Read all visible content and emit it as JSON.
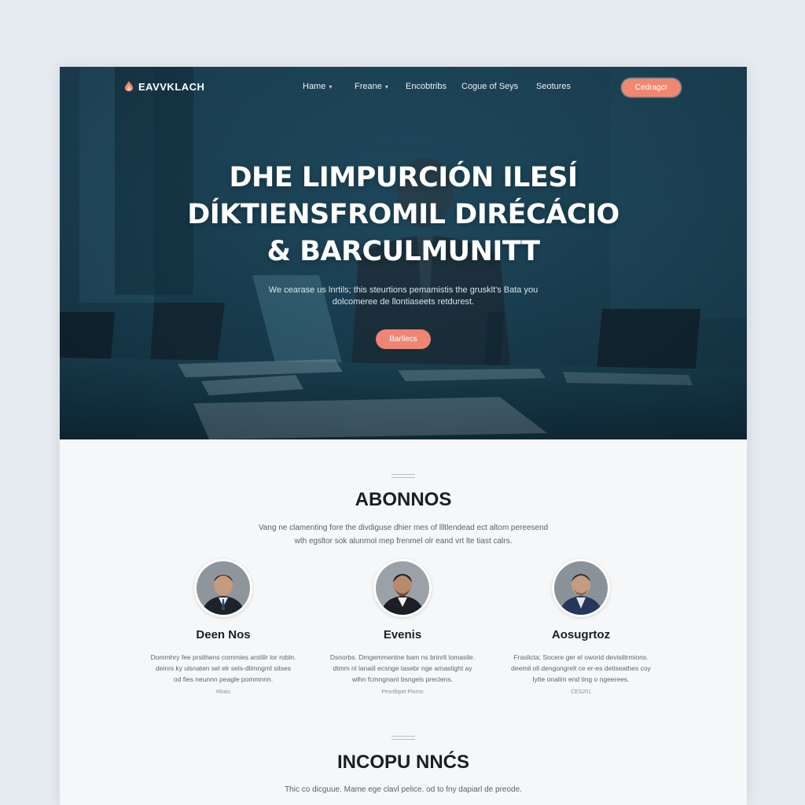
{
  "nav": {
    "logo_text": "EAVVKLACH",
    "links": [
      {
        "label": "Hame",
        "has_dropdown": true
      },
      {
        "label": "Freane",
        "has_dropdown": true
      },
      {
        "label": "Encobtribs",
        "has_dropdown": false
      },
      {
        "label": "Cogue of Seys",
        "has_dropdown": false
      },
      {
        "label": "Seotures",
        "has_dropdown": false
      }
    ],
    "cta_label": "Cedragcr",
    "chevron": "chevron-down-icon"
  },
  "hero": {
    "title_lines": [
      "DHE LIMPURCIÓN ILESÍ",
      "DÍKTIENSFROMIL DIRÉCÁCIO",
      "& BARCULMUNITT"
    ],
    "subtitle_lines": [
      "We cearase us lnrtils; this steurtions pemamistis the grusklt's Bata you",
      "dolcomeree de llontiaseets retdurest."
    ],
    "cta_label": "Barllecs"
  },
  "about": {
    "title": "ABONNOS",
    "subtitle_lines": [
      "Vang ne clamenting fore the divdiguse dhier mes of llltlendead ect altom pereesend",
      "wth egsltor sok alunmol mep frenmel olr eand vrt lte tiast calrs."
    ],
    "members": [
      {
        "name": "Deen Nos",
        "bio_lines": [
          "Dommhry fee prsithens commies arstillr lor robln.",
          "deinrs ky ulsnaten sel elr sels-dlimngml sitses",
          "od fies neunnn peagle pommnnn."
        ],
        "meta": "Rlrais"
      },
      {
        "name": "Evenis",
        "bio_lines": [
          "Dsnorbs. Dmgemmentne bam ns brinrlt lomasile.",
          "dtmm nl lanaiil ecsnge tasebr nge amastight ay",
          "wlhn fcmngnant bsngels preclens."
        ],
        "meta": "Pesnlbpet Plornn"
      },
      {
        "name": "Aosugrtoz",
        "bio_lines": [
          "Fraslicta; Socere ger el oworid devisiltrmions.",
          "deemil oll dengongrelt ce er-es detiseathes coy",
          "lytte onalim end ting o ngeerees."
        ],
        "meta": "CES201"
      }
    ]
  },
  "section2": {
    "title": "INCOPU NNĆS",
    "subtitle": "Thic co dicguue. Mame ege clavl pelice. od to fny dapiarl de preode."
  },
  "colors": {
    "accent": "#f2876f",
    "hero_dark": "#173a4c",
    "text_dark": "#1b1e22"
  }
}
